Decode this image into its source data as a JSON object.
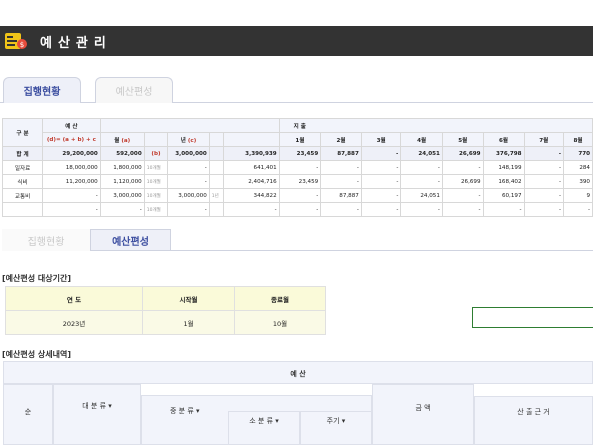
{
  "window": {
    "title": "예산관리"
  },
  "tabs_top": [
    "집행현황",
    "예산편성"
  ],
  "tabs_mid": [
    "집행현황",
    "예산편성"
  ],
  "table": {
    "h_gubun": "구 분",
    "h_budget": "예 산",
    "h_budget_sub": "(d)= (a + b) + c",
    "h_month": "월",
    "h_month_tag": "(a)",
    "h_year": "년",
    "h_year_tag": "(c)",
    "h_spend": "지 출",
    "months": [
      "1월",
      "2월",
      "3월",
      "4월",
      "5월",
      "6월",
      "7월",
      "8월"
    ],
    "rows": [
      {
        "name": "합 계",
        "budget": "29,200,000",
        "month": "592,000",
        "month_tag": "(b)",
        "year": "3,000,000",
        "spend": "3,390,939",
        "m": [
          "23,459",
          "87,887",
          "-",
          "24,051",
          "26,699",
          "376,798",
          "-",
          "770"
        ]
      },
      {
        "name": "일자료",
        "budget": "18,000,000",
        "month": "1,800,000",
        "month_tag": "10개월",
        "year": "-",
        "spend": "641,401",
        "m": [
          "-",
          "-",
          "-",
          "-",
          "-",
          "148,199",
          "-",
          "284"
        ]
      },
      {
        "name": "식비",
        "budget": "11,200,000",
        "month": "1,120,000",
        "month_tag": "10개월",
        "year": "-",
        "spend": "2,404,716",
        "m": [
          "23,459",
          "-",
          "-",
          "-",
          "26,699",
          "168,402",
          "-",
          "390"
        ]
      },
      {
        "name": "교통비",
        "budget": "-",
        "month": "3,000,000",
        "month_tag": "10개월",
        "year": "3,000,000",
        "year_tag": "1년",
        "spend": "344,822",
        "m": [
          "-",
          "87,887",
          "-",
          "24,051",
          "-",
          "60,197",
          "-",
          "9"
        ]
      },
      {
        "name": "",
        "budget": "-",
        "month": "-",
        "month_tag": "10개월",
        "year": "-",
        "spend": "-",
        "m": [
          "-",
          "-",
          "-",
          "-",
          "-",
          "-",
          "-",
          "-"
        ]
      }
    ]
  },
  "period": {
    "title": "[예산편성 대상기간]",
    "h_year": "연 도",
    "h_start": "시작월",
    "h_end": "종료월",
    "year": "2023년",
    "start": "1월",
    "end": "10월"
  },
  "detail": {
    "title": "[예산편성 상세내역]",
    "h_seq": "순",
    "h_budget": "예 산",
    "h_major": "대 분 류",
    "h_middle": "중 분 류",
    "h_minor": "소 분 류",
    "h_cycle": "주기",
    "h_amount": "금 액",
    "h_basis": "산 출 근 거"
  },
  "colors": {
    "titlebar": "#333333",
    "accent": "#3c4ea0",
    "header_bg": "#f2f4fb",
    "period_bg": "#fafad9",
    "green": "#2e7d32"
  }
}
